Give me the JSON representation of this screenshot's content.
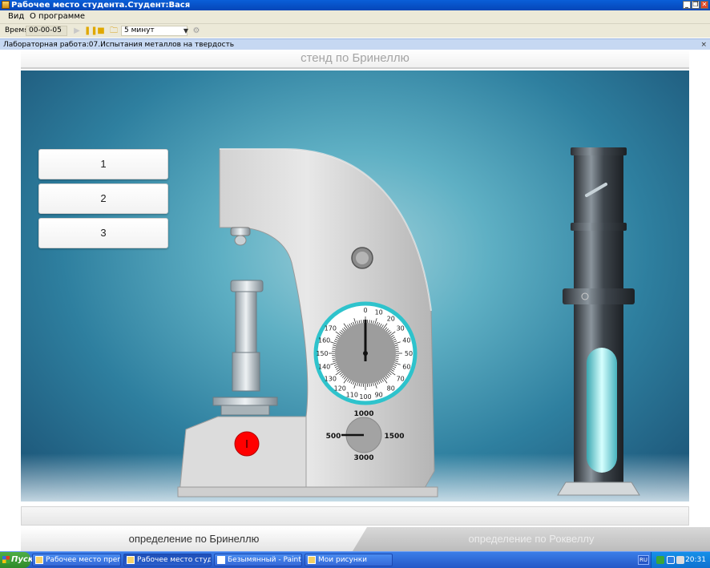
{
  "window": {
    "title": "Рабочее место студента.Студент:Вася",
    "btn_min": "_",
    "btn_restore": "❐",
    "btn_close": "✕"
  },
  "menu": {
    "items": [
      "Вид",
      "О программе"
    ]
  },
  "toolbar": {
    "time_label": "Время",
    "time_value": "00-00-05",
    "duration": "5 минут",
    "icons": [
      "play-icon",
      "pause-icon",
      "stop-icon",
      "folder-icon",
      "dropdown-icon",
      "settings-icon"
    ]
  },
  "lab": {
    "title": "Лабораторная работа:07.Испытания металлов на твердость",
    "close": "×"
  },
  "stand": {
    "title": "стенд по Бринеллю",
    "choices": [
      "1",
      "2",
      "3"
    ],
    "dial": {
      "ticks": [
        "0",
        "10",
        "20",
        "30",
        "40",
        "50",
        "60",
        "70",
        "80",
        "90",
        "100",
        "110",
        "120",
        "130",
        "140",
        "150",
        "160",
        "170"
      ],
      "needle_value": 0
    },
    "load_selector": {
      "options": [
        "1000",
        "1500",
        "3000",
        "500"
      ],
      "selected": "500"
    },
    "start_button_color": "#ff0000",
    "accent_ring_color": "#2ec3cc"
  },
  "tabs": [
    {
      "label": "определение по Бринеллю",
      "active": true
    },
    {
      "label": "определение по Роквеллу",
      "active": false
    }
  ],
  "taskbar": {
    "start": "Пуск",
    "tasks": [
      "Рабочее место препода...",
      "Рабочее место студ...",
      "Безымянный - Paint",
      "Мои рисунки"
    ],
    "lang": "RU",
    "clock": "20:31"
  }
}
